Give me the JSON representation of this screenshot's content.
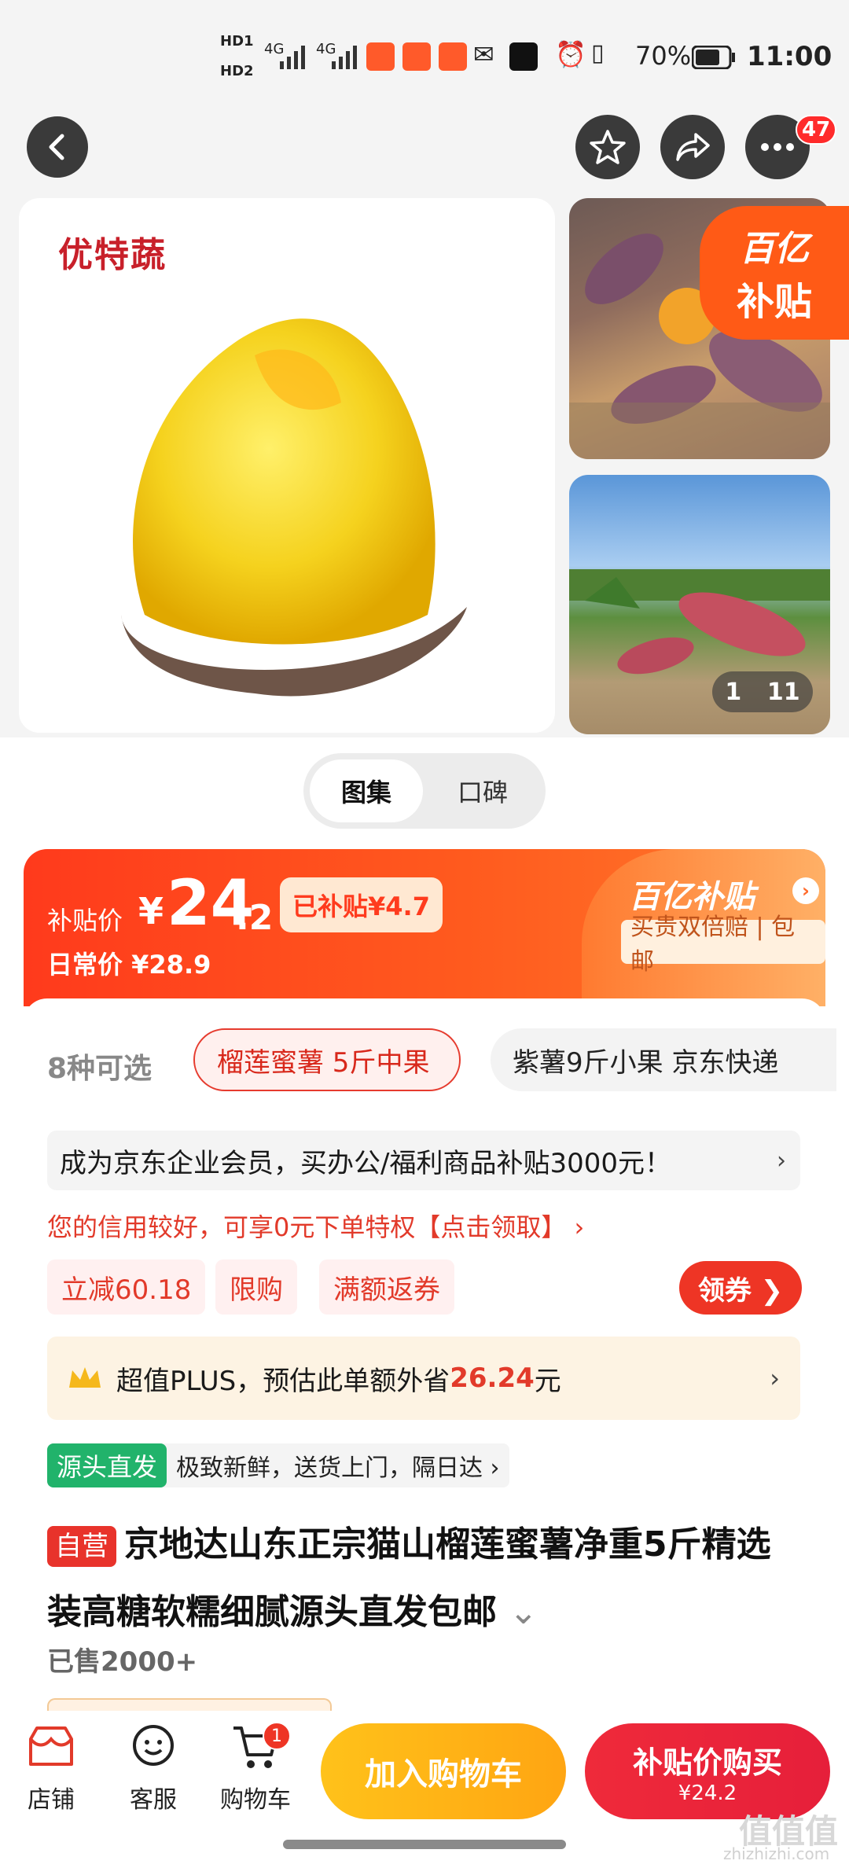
{
  "status_bar": {
    "time": "11:00",
    "battery": "70%",
    "hd1": "HD1",
    "hd2": "HD2",
    "net1": "4G",
    "net2": "4G"
  },
  "header": {
    "cart_count_badge": "47"
  },
  "gallery": {
    "brand": "优特蔬",
    "subsidy_badge_line1": "百亿",
    "subsidy_badge_line2": "补贴",
    "counter_current": "1",
    "counter_total": "11"
  },
  "tabs": [
    {
      "label": "图集",
      "active": true
    },
    {
      "label": "口碑",
      "active": false
    }
  ],
  "price": {
    "label": "补贴价",
    "currency": "¥",
    "integer": "24",
    "decimal": ".2",
    "subsidized": "已补贴¥4.7",
    "daily_label": "日常价 ¥28.9",
    "program_title": "百亿补贴",
    "program_guarantee": "买贵双倍赔 | 包邮"
  },
  "variants": {
    "count_label": "8种可选",
    "options": [
      "榴莲蜜薯 5斤中果",
      "紫薯9斤小果 京东快递"
    ]
  },
  "notice": {
    "enterprise": "成为京东企业会员，买办公/福利商品补贴3000元！",
    "credit": "您的信用较好，可享0元下单特权【点击领取】 ›"
  },
  "promos": {
    "tags": [
      "立减60.18",
      "限购",
      "满额返券"
    ],
    "coupon_button": "领券 ❯"
  },
  "plus": {
    "prefix": "超值PLUS，预估此单额外省",
    "amount": "26.24",
    "suffix": "元"
  },
  "source": {
    "tag": "源头直发",
    "text": "极致新鲜，送货上门，隔日达 ›"
  },
  "product": {
    "self_tag": "自营",
    "title": "京地达山东正宗猫山榴莲蜜薯净重5斤精选装高糖软糯细腻源头直发包邮",
    "sold": "已售2000+"
  },
  "bottom_bar": {
    "store": "店铺",
    "service": "客服",
    "cart": "购物车",
    "cart_badge": "1",
    "add_to_cart": "加入购物车",
    "buy_line1": "补贴价购买",
    "buy_line2": "¥24.2"
  },
  "watermark": {
    "main": "值值值",
    "sub": "zhizhizhi.com"
  },
  "colors": {
    "accent_red": "#ee3525",
    "subsidy_orange": "#ff5a1e",
    "cart_yellow": "#ffb316",
    "source_green": "#21b36b"
  }
}
